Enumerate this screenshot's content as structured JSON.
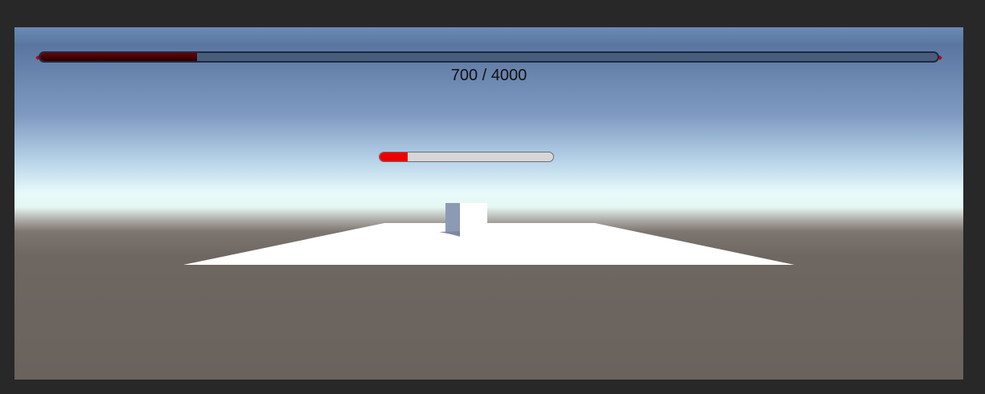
{
  "boss_health": {
    "current": 700,
    "max": 4000,
    "label": "700 / 4000",
    "fill_color": "#4a0000",
    "track_color": "#485d7c"
  },
  "enemy_health": {
    "fraction": 0.16,
    "fill_color": "#ee0000",
    "track_color": "#d6d6d6"
  },
  "scene": {
    "floor_color": "#ffffff",
    "pillar_color": "#8c9bb3",
    "ground_color": "#6b635e"
  }
}
